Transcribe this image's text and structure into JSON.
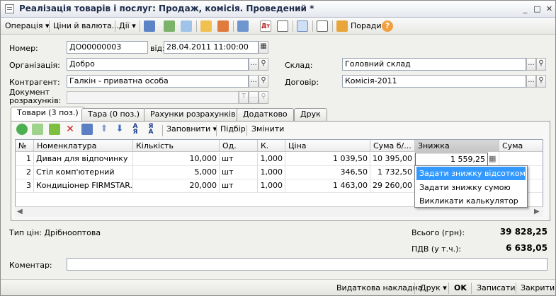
{
  "window": {
    "title": "Реалізація товарів і послуг: Продаж, комісія. Проведений *"
  },
  "toolbar": {
    "operation": "Операція",
    "prices": "Ціни й валюта...",
    "actions": "Дії",
    "help": "Поради"
  },
  "form": {
    "number_label": "Номер:",
    "number": "ДО00000003",
    "date_label": "від:",
    "date": "28.04.2011 11:00:00",
    "org_label": "Організація:",
    "org": "Добро",
    "warehouse_label": "Склад:",
    "warehouse": "Головний склад",
    "contractor_label": "Контрагент:",
    "contractor": "Галкін - приватна особа",
    "contract_label": "Договір:",
    "contract": "Комісія-2011",
    "settlement_label_1": "Документ",
    "settlement_label_2": "розрахунків:",
    "settlement": ""
  },
  "tabs": [
    "Товари (3 поз.)",
    "Тара (0 поз.)",
    "Рахунки розрахунків",
    "Додатково",
    "Друк"
  ],
  "grid_toolbar": {
    "fill": "Заповнити",
    "select": "Підбір",
    "change": "Змінити"
  },
  "table": {
    "headers": [
      "№",
      "Номенклатура",
      "Кількість",
      "Од.",
      "К.",
      "Ціна",
      "Сума б/...",
      "Знижка",
      "Сума"
    ],
    "rows": [
      [
        "1",
        "Диван для відпочинку",
        "10,000",
        "шт",
        "1,000",
        "1 039,50",
        "10 395,00",
        "1 559,25",
        ""
      ],
      [
        "2",
        "Стіл комп'ютерний",
        "5,000",
        "шт",
        "1,000",
        "346,50",
        "1 732,50",
        "",
        ""
      ],
      [
        "3",
        "Кондиціонер FIRMSTAR...",
        "20,000",
        "шт",
        "1,000",
        "1 463,00",
        "29 260,00",
        "",
        ""
      ]
    ]
  },
  "context_menu": [
    "Задати знижку відсотком",
    "Задати знижку сумою",
    "Викликати калькулятор"
  ],
  "summary": {
    "price_type": "Тип цін: Дрібнооптова",
    "total_label": "Всього (грн):",
    "total": "39 828,25",
    "vat_label": "ПДВ (у т.ч.):",
    "vat": "6 638,05"
  },
  "comment": {
    "label": "Коментар:",
    "value": ""
  },
  "bottom": {
    "invoice": "Видаткова накладна",
    "print": "Друк",
    "ok": "OK",
    "save": "Записати",
    "close": "Закрити"
  }
}
